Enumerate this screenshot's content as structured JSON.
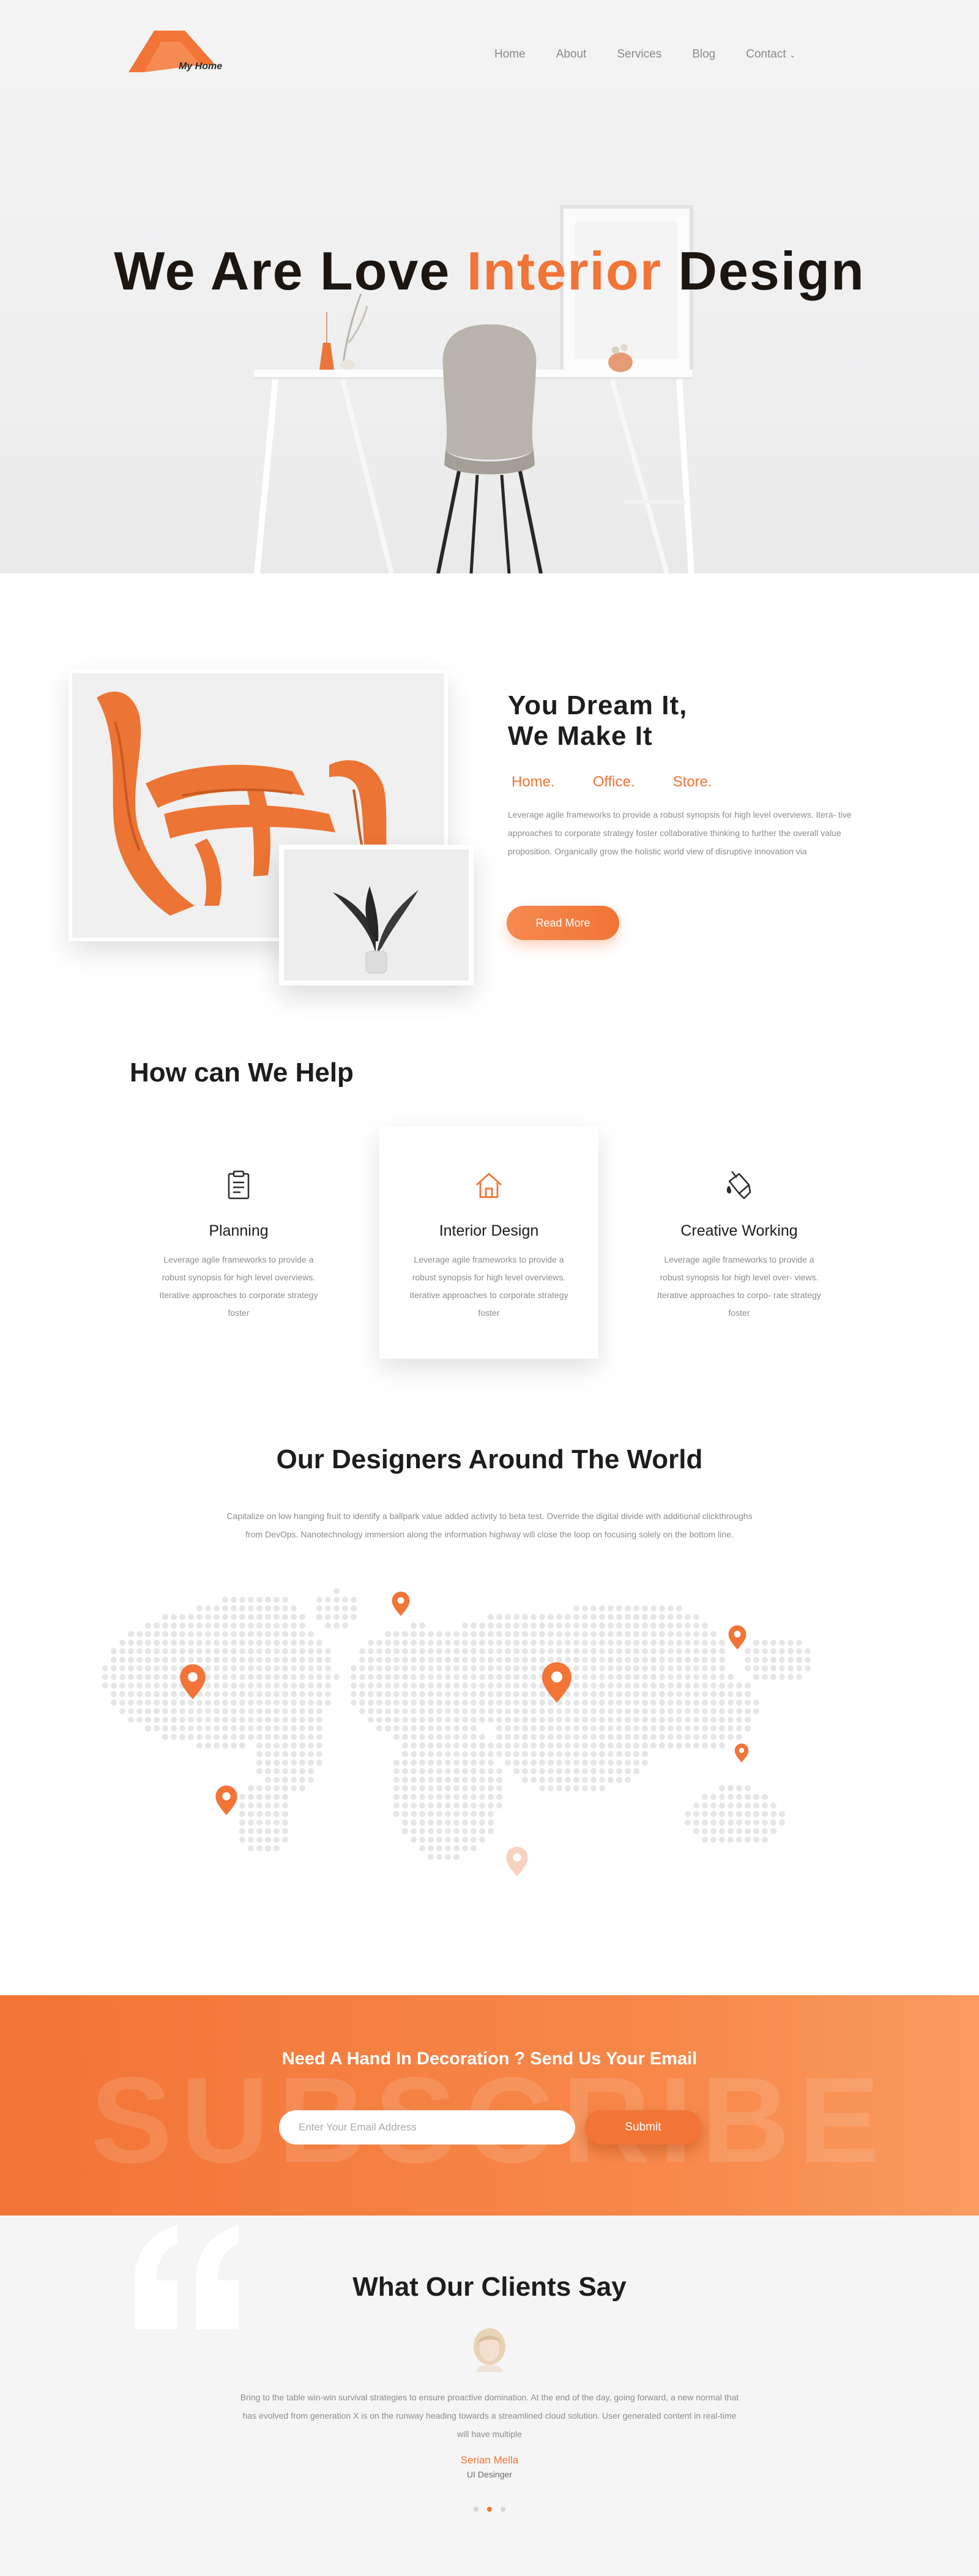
{
  "brand": {
    "name": "My Home",
    "accent": "#f27436"
  },
  "nav": {
    "items": [
      {
        "label": "Home"
      },
      {
        "label": "About"
      },
      {
        "label": "Services"
      },
      {
        "label": "Blog"
      },
      {
        "label": "Contact"
      }
    ],
    "contact_chevron_icon": "chevron-down-icon"
  },
  "hero": {
    "title_pre": "We Are Love ",
    "title_accent": "Interior",
    "title_post": " Design"
  },
  "about": {
    "title_line1": "You Dream It,",
    "title_line2": "We Make It",
    "tags": [
      "Home.",
      "Office.",
      "Store."
    ],
    "text": "Leverage agile frameworks to provide a robust synopsis for high level overviews. Itera- tive approaches to corporate strategy foster collaborative thinking to further the overall value proposition. Organically grow the holistic world view of disruptive innovation via",
    "button": "Read More"
  },
  "services": {
    "title": "How can We Help",
    "items": [
      {
        "icon": "clipboard-icon",
        "title": "Planning",
        "text": "Leverage agile frameworks to provide a robust synopsis for high level overviews. Iterative approaches to corporate strategy foster"
      },
      {
        "icon": "house-icon",
        "title": "Interior Design",
        "text": "Leverage agile frameworks to provide a robust synopsis for high level overviews. Iterative approaches to corporate strategy foster"
      },
      {
        "icon": "paint-bucket-icon",
        "title": "Creative Working",
        "text": "Leverage agile frameworks to provide a robust synopsis for high level over- views. Iterative approaches to corpo- rate strategy foster"
      }
    ]
  },
  "designers": {
    "title": "Our Designers Around  The World",
    "text": "Capitalize on low hanging fruit to identify a ballpark value added activity to beta test. Override the digital divide with additional clickthroughs from DevOps. Nanotechnology immersion along the information highway will close the loop on focusing solely on the bottom line."
  },
  "subscribe": {
    "background_word": "SUBSCRIBE",
    "title": "Need A Hand In Decoration ? Send Us Your Email",
    "placeholder": "Enter Your Email Address",
    "button": "Submit"
  },
  "testimonials": {
    "title": "What Our Clients Say",
    "text": "Bring to the table win-win survival strategies to ensure proactive domination. At the end of the day, going forward, a new normal that has evolved from generation X is on the runway heading towards a streamlined cloud solution. User generated content in real-time will have multiple",
    "name": "Serian Mella",
    "role": "UI Desinger",
    "slides_total": 3,
    "active_slide": 2
  }
}
